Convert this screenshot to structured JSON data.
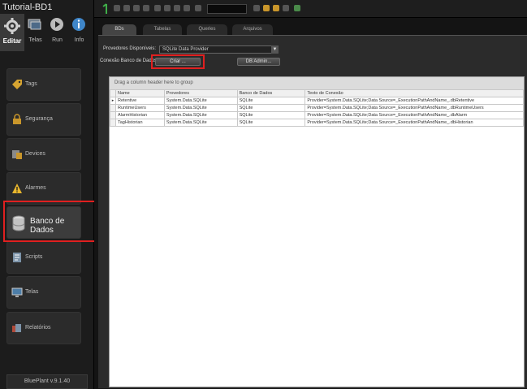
{
  "window": {
    "title": "Tutorial-BD1"
  },
  "modes": [
    {
      "label": "Editar",
      "icon": "gear-icon"
    },
    {
      "label": "Telas",
      "icon": "screens-icon"
    },
    {
      "label": "Run",
      "icon": "play-icon"
    },
    {
      "label": "Info",
      "icon": "info-icon"
    }
  ],
  "nav": [
    {
      "label": "Tags",
      "icon": "tag-icon"
    },
    {
      "label": "Segurança",
      "icon": "lock-icon"
    },
    {
      "label": "Devices",
      "icon": "device-icon"
    },
    {
      "label": "Alarmes",
      "icon": "warning-icon"
    },
    {
      "label": "Banco de Dados",
      "icon": "database-icon"
    },
    {
      "label": "Scripts",
      "icon": "script-icon"
    },
    {
      "label": "Telas",
      "icon": "display-icon"
    },
    {
      "label": "Relatórios",
      "icon": "report-icon"
    }
  ],
  "version": "BluePlant v.9.1.40",
  "tabs": [
    "BDs",
    "Tabelas",
    "Queries",
    "Arquivos"
  ],
  "providers_label": "Provedores Disponíveis:",
  "provider_value": "SQLite Data Provider",
  "connection_label": "Conexão Banco de Dados:",
  "create_button": "Criar ...",
  "db_admin_button": "DB Admin...",
  "grid": {
    "group_hint": "Drag a column header here to group",
    "columns": [
      "Name",
      "Provedores",
      "Banco de Dados",
      "Texto de Conexão"
    ],
    "rows": [
      [
        "Retentive",
        "System.Data.SQLite",
        "SQLite",
        "Provider=System.Data.SQLite;Data Source=_ExecutionPathAndName_.dbRetentive"
      ],
      [
        "RuntimeUsers",
        "System.Data.SQLite",
        "SQLite",
        "Provider=System.Data.SQLite;Data Source=_ExecutionPathAndName_.dbRuntimeUsers"
      ],
      [
        "AlarmHistorian",
        "System.Data.SQLite",
        "SQLite",
        "Provider=System.Data.SQLite;Data Source=_ExecutionPathAndName_.dbAlarm"
      ],
      [
        "TagHistorian",
        "System.Data.SQLite",
        "SQLite",
        "Provider=System.Data.SQLite;Data Source=_ExecutionPathAndName_.dbHistorian"
      ]
    ]
  },
  "colors": {
    "highlight": "#e02020",
    "sidebar": "#1c1c1c",
    "panel": "#2b2b2b"
  }
}
